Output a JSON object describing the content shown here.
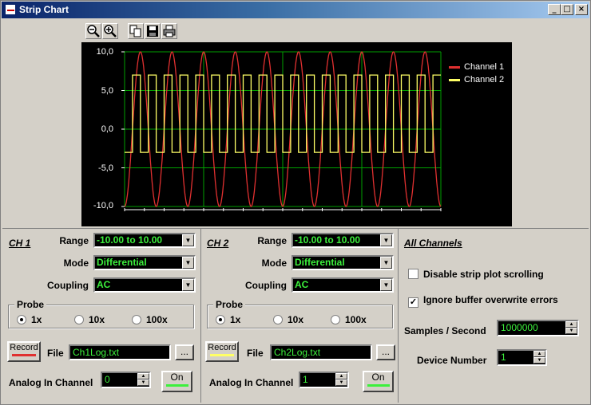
{
  "window": {
    "title": "Strip Chart",
    "minimize": "_",
    "maximize": "□",
    "close": "×"
  },
  "toolbar": {
    "tools": [
      "zoom-out-icon",
      "zoom-in-icon",
      "copy-icon",
      "save-icon",
      "print-icon"
    ]
  },
  "chart_data": {
    "type": "line",
    "title": "",
    "xlabel": "",
    "ylabel": "",
    "ylim": [
      -10,
      10
    ],
    "yticks": [
      "10,0",
      "5,0",
      "0,0",
      "-5,0",
      "-10,0"
    ],
    "grid": true,
    "legend_position": "top-right",
    "series": [
      {
        "name": "Channel 1",
        "color": "#e03030",
        "shape": "sine",
        "amplitude": 10.0,
        "cycles": 10
      },
      {
        "name": "Channel 2",
        "color": "#ffff66",
        "shape": "square",
        "high": 7.0,
        "low": -3.0,
        "cycles": 20
      }
    ]
  },
  "ch1": {
    "title": "CH 1",
    "range_label": "Range",
    "range_value": "-10.00 to 10.00",
    "mode_label": "Mode",
    "mode_value": "Differential",
    "coupling_label": "Coupling",
    "coupling_value": "AC",
    "probe_title": "Probe",
    "probe_options": [
      "1x",
      "10x",
      "100x"
    ],
    "probe_selected": "1x",
    "record_label": "Record",
    "record_color": "#e03030",
    "file_label": "File",
    "file_value": "Ch1Log.txt",
    "browse_label": "...",
    "analog_label": "Analog In Channel",
    "analog_value": "0",
    "on_label": "On"
  },
  "ch2": {
    "title": "CH 2",
    "range_label": "Range",
    "range_value": "-10.00 to 10.00",
    "mode_label": "Mode",
    "mode_value": "Differential",
    "coupling_label": "Coupling",
    "coupling_value": "AC",
    "probe_title": "Probe",
    "probe_options": [
      "1x",
      "10x",
      "100x"
    ],
    "probe_selected": "1x",
    "record_label": "Record",
    "record_color": "#ffff66",
    "file_label": "File",
    "file_value": "Ch2Log.txt",
    "browse_label": "...",
    "analog_label": "Analog In Channel",
    "analog_value": "1",
    "on_label": "On"
  },
  "all": {
    "title": "All Channels",
    "disable_scroll_label": "Disable strip plot scrolling",
    "disable_scroll_checked": false,
    "ignore_errors_label": "Ignore buffer overwrite errors",
    "ignore_errors_checked": true,
    "samples_label": "Samples / Second",
    "samples_value": "1000000",
    "device_label": "Device Number",
    "device_value": "1"
  }
}
